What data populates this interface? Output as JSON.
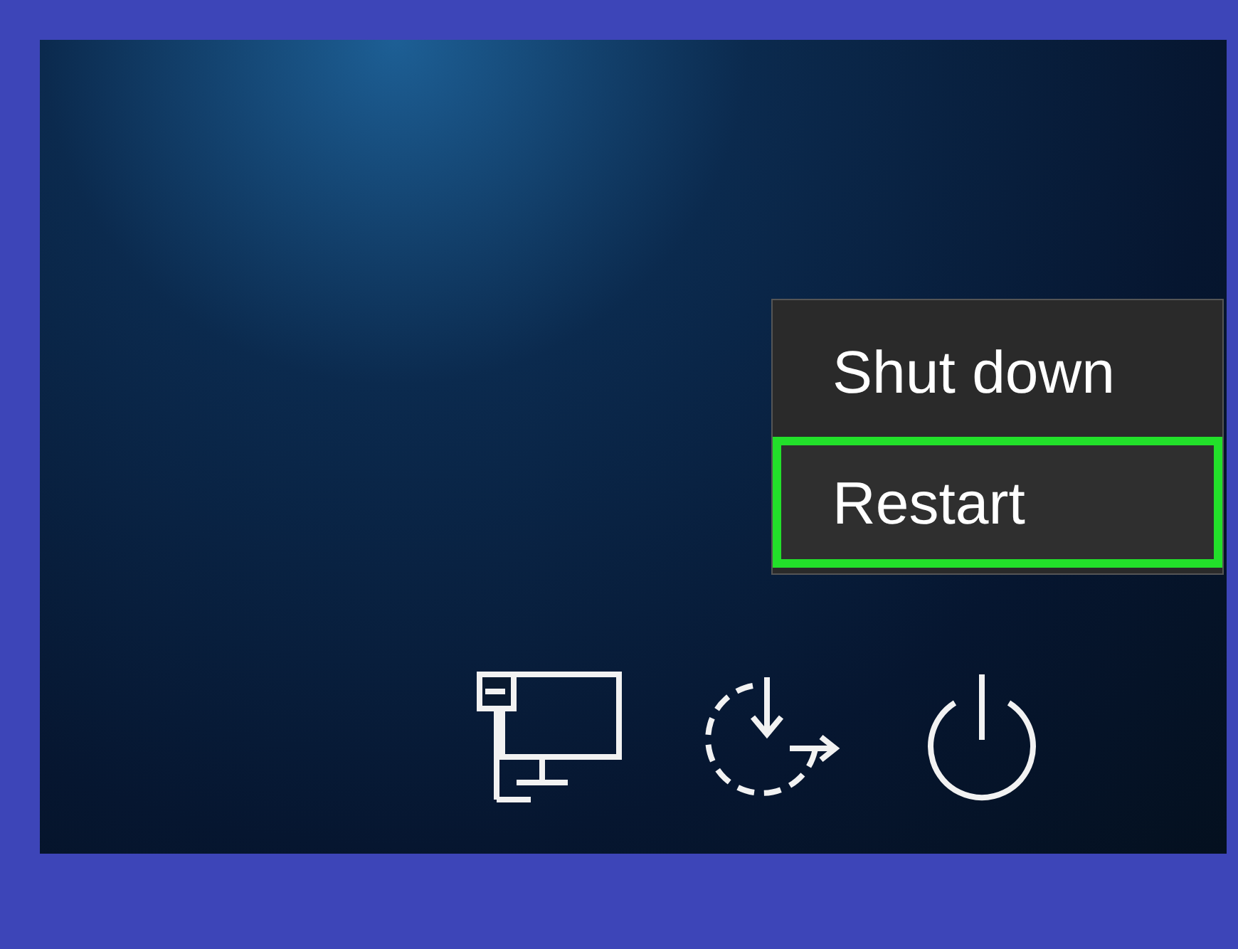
{
  "power_menu": {
    "items": [
      {
        "label": "Shut down",
        "selected": false
      },
      {
        "label": "Restart",
        "selected": true
      }
    ]
  },
  "bottom_icons": [
    {
      "kind": "network"
    },
    {
      "kind": "ease_of_access"
    },
    {
      "kind": "power"
    }
  ]
}
